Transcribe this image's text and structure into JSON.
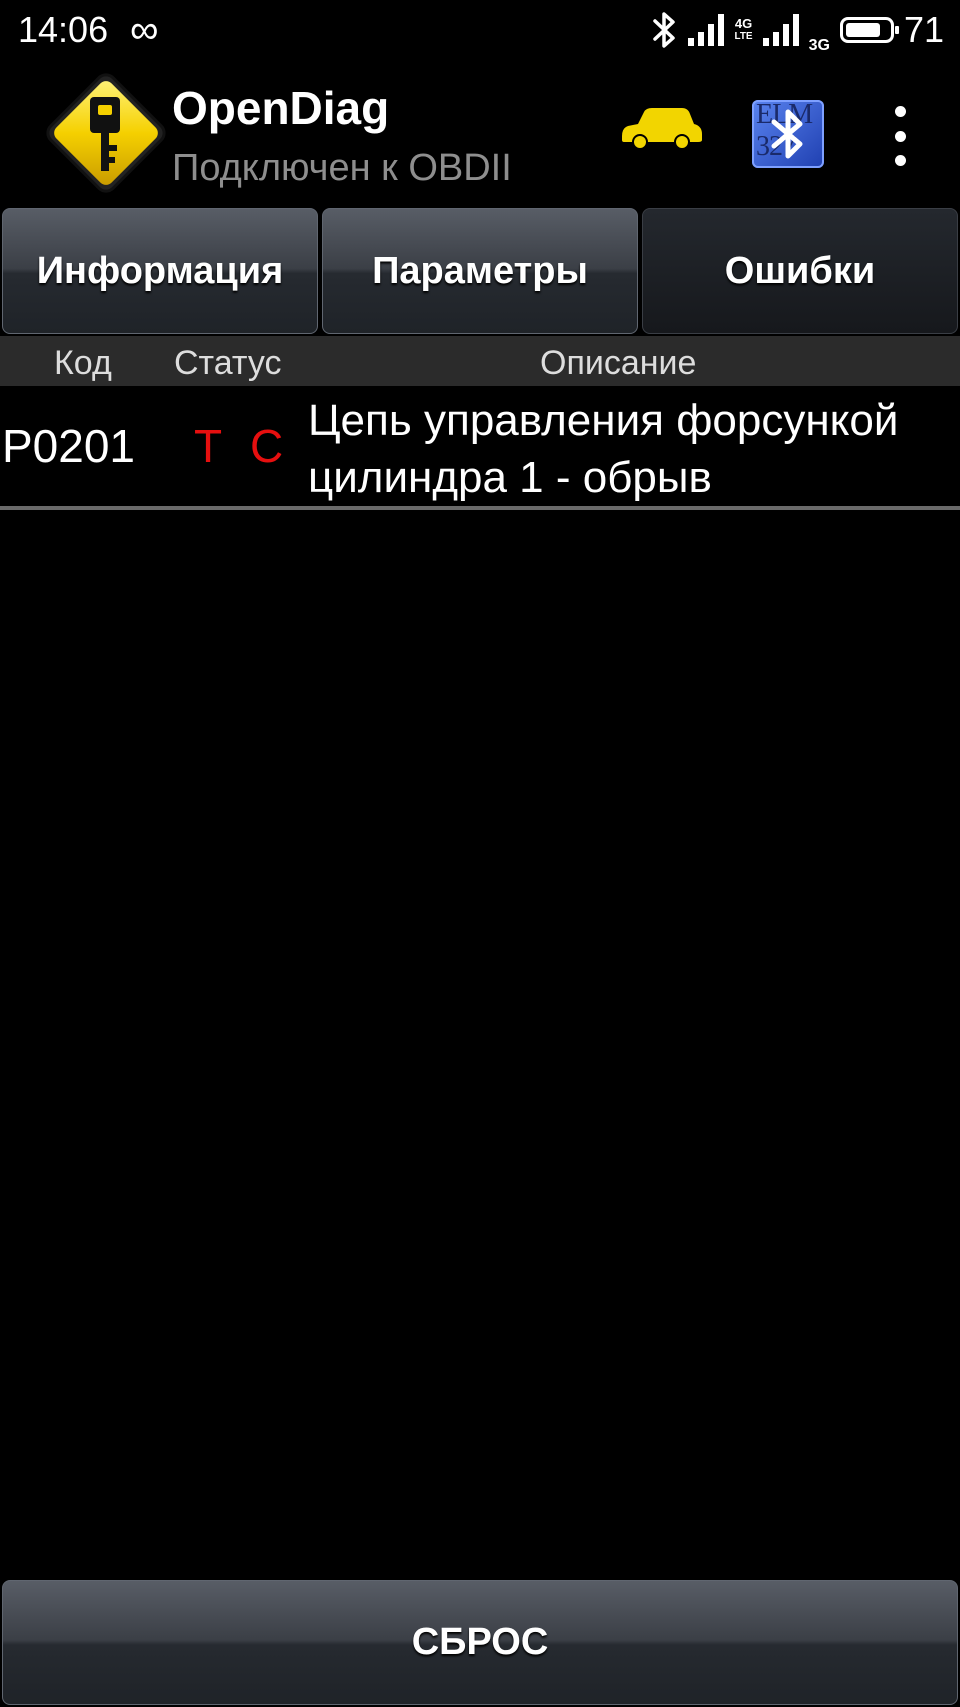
{
  "status_bar": {
    "time": "14:06",
    "loop_glyph": "∞",
    "bluetooth_glyph": "✱",
    "network_1": "4G",
    "network_1_sub": "LTE",
    "network_2": "3G",
    "battery_percent": "71"
  },
  "header": {
    "title": "OpenDiag",
    "subtitle": "Подключен к OBDII",
    "icons": [
      "key-warning-logo-icon",
      "car-icon",
      "elm327-bluetooth-icon",
      "overflow-menu-icon"
    ],
    "elm_text_top": "ELM",
    "elm_text_bottom": "327"
  },
  "tabs": [
    {
      "label": "Информация",
      "active": false
    },
    {
      "label": "Параметры",
      "active": false
    },
    {
      "label": "Ошибки",
      "active": true
    }
  ],
  "table": {
    "columns": [
      "Код",
      "Статус",
      "Описание"
    ],
    "rows": [
      {
        "code": "P0201",
        "status": [
          "T",
          "C"
        ],
        "description_lines": [
          "Цепь управления форсункой",
          "цилиндра 1 - обрыв"
        ]
      }
    ]
  },
  "footer": {
    "reset_label": "СБРОС"
  },
  "colors": {
    "background": "#000000",
    "status_red": "#e60f0f",
    "logo_yellow": "#f5d000",
    "car_yellow": "#f2d500",
    "elm_blue": "#2f55d4"
  }
}
